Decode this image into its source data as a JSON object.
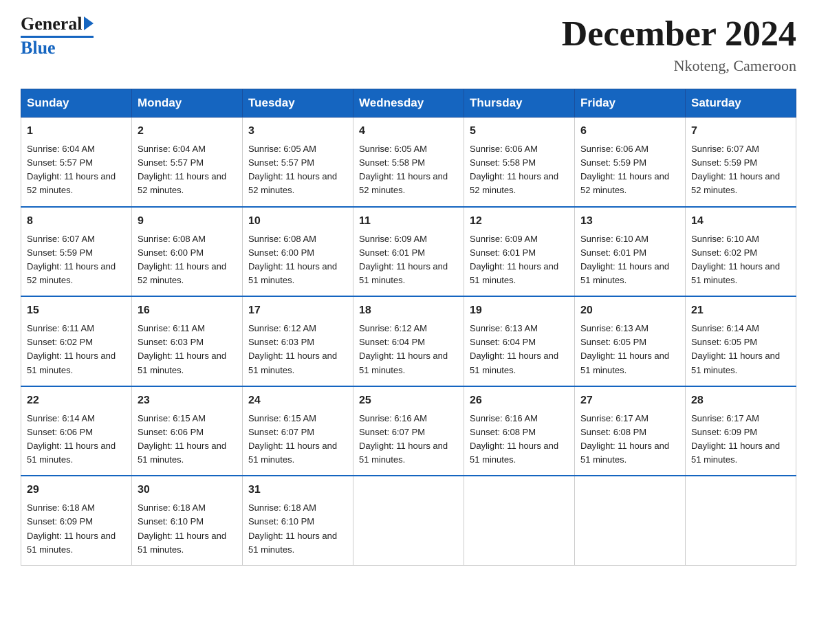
{
  "logo": {
    "general": "General",
    "blue": "Blue",
    "triangle": "▶"
  },
  "title": "December 2024",
  "location": "Nkoteng, Cameroon",
  "days_header": [
    "Sunday",
    "Monday",
    "Tuesday",
    "Wednesday",
    "Thursday",
    "Friday",
    "Saturday"
  ],
  "weeks": [
    [
      {
        "day": "1",
        "sunrise": "6:04 AM",
        "sunset": "5:57 PM",
        "daylight": "11 hours and 52 minutes."
      },
      {
        "day": "2",
        "sunrise": "6:04 AM",
        "sunset": "5:57 PM",
        "daylight": "11 hours and 52 minutes."
      },
      {
        "day": "3",
        "sunrise": "6:05 AM",
        "sunset": "5:57 PM",
        "daylight": "11 hours and 52 minutes."
      },
      {
        "day": "4",
        "sunrise": "6:05 AM",
        "sunset": "5:58 PM",
        "daylight": "11 hours and 52 minutes."
      },
      {
        "day": "5",
        "sunrise": "6:06 AM",
        "sunset": "5:58 PM",
        "daylight": "11 hours and 52 minutes."
      },
      {
        "day": "6",
        "sunrise": "6:06 AM",
        "sunset": "5:59 PM",
        "daylight": "11 hours and 52 minutes."
      },
      {
        "day": "7",
        "sunrise": "6:07 AM",
        "sunset": "5:59 PM",
        "daylight": "11 hours and 52 minutes."
      }
    ],
    [
      {
        "day": "8",
        "sunrise": "6:07 AM",
        "sunset": "5:59 PM",
        "daylight": "11 hours and 52 minutes."
      },
      {
        "day": "9",
        "sunrise": "6:08 AM",
        "sunset": "6:00 PM",
        "daylight": "11 hours and 52 minutes."
      },
      {
        "day": "10",
        "sunrise": "6:08 AM",
        "sunset": "6:00 PM",
        "daylight": "11 hours and 51 minutes."
      },
      {
        "day": "11",
        "sunrise": "6:09 AM",
        "sunset": "6:01 PM",
        "daylight": "11 hours and 51 minutes."
      },
      {
        "day": "12",
        "sunrise": "6:09 AM",
        "sunset": "6:01 PM",
        "daylight": "11 hours and 51 minutes."
      },
      {
        "day": "13",
        "sunrise": "6:10 AM",
        "sunset": "6:01 PM",
        "daylight": "11 hours and 51 minutes."
      },
      {
        "day": "14",
        "sunrise": "6:10 AM",
        "sunset": "6:02 PM",
        "daylight": "11 hours and 51 minutes."
      }
    ],
    [
      {
        "day": "15",
        "sunrise": "6:11 AM",
        "sunset": "6:02 PM",
        "daylight": "11 hours and 51 minutes."
      },
      {
        "day": "16",
        "sunrise": "6:11 AM",
        "sunset": "6:03 PM",
        "daylight": "11 hours and 51 minutes."
      },
      {
        "day": "17",
        "sunrise": "6:12 AM",
        "sunset": "6:03 PM",
        "daylight": "11 hours and 51 minutes."
      },
      {
        "day": "18",
        "sunrise": "6:12 AM",
        "sunset": "6:04 PM",
        "daylight": "11 hours and 51 minutes."
      },
      {
        "day": "19",
        "sunrise": "6:13 AM",
        "sunset": "6:04 PM",
        "daylight": "11 hours and 51 minutes."
      },
      {
        "day": "20",
        "sunrise": "6:13 AM",
        "sunset": "6:05 PM",
        "daylight": "11 hours and 51 minutes."
      },
      {
        "day": "21",
        "sunrise": "6:14 AM",
        "sunset": "6:05 PM",
        "daylight": "11 hours and 51 minutes."
      }
    ],
    [
      {
        "day": "22",
        "sunrise": "6:14 AM",
        "sunset": "6:06 PM",
        "daylight": "11 hours and 51 minutes."
      },
      {
        "day": "23",
        "sunrise": "6:15 AM",
        "sunset": "6:06 PM",
        "daylight": "11 hours and 51 minutes."
      },
      {
        "day": "24",
        "sunrise": "6:15 AM",
        "sunset": "6:07 PM",
        "daylight": "11 hours and 51 minutes."
      },
      {
        "day": "25",
        "sunrise": "6:16 AM",
        "sunset": "6:07 PM",
        "daylight": "11 hours and 51 minutes."
      },
      {
        "day": "26",
        "sunrise": "6:16 AM",
        "sunset": "6:08 PM",
        "daylight": "11 hours and 51 minutes."
      },
      {
        "day": "27",
        "sunrise": "6:17 AM",
        "sunset": "6:08 PM",
        "daylight": "11 hours and 51 minutes."
      },
      {
        "day": "28",
        "sunrise": "6:17 AM",
        "sunset": "6:09 PM",
        "daylight": "11 hours and 51 minutes."
      }
    ],
    [
      {
        "day": "29",
        "sunrise": "6:18 AM",
        "sunset": "6:09 PM",
        "daylight": "11 hours and 51 minutes."
      },
      {
        "day": "30",
        "sunrise": "6:18 AM",
        "sunset": "6:10 PM",
        "daylight": "11 hours and 51 minutes."
      },
      {
        "day": "31",
        "sunrise": "6:18 AM",
        "sunset": "6:10 PM",
        "daylight": "11 hours and 51 minutes."
      },
      null,
      null,
      null,
      null
    ]
  ]
}
